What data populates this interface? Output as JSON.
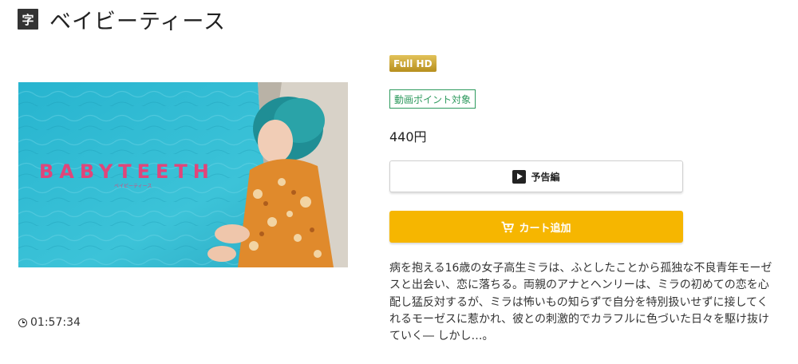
{
  "header": {
    "subtitle_badge": "字",
    "title": "ベイビーティース"
  },
  "thumbnail": {
    "overlay_title": "BABYTEETH",
    "overlay_subtitle": "ベイビーティース",
    "accent_color": "#e0457a"
  },
  "duration": {
    "icon": "clock-icon",
    "value": "01:57:34"
  },
  "badges": {
    "quality": "Full HD",
    "point": "動画ポイント対象"
  },
  "price": "440円",
  "buttons": {
    "trailer": {
      "icon": "play-icon",
      "label": "予告編"
    },
    "cart": {
      "icon": "cart-icon",
      "label": "カート追加",
      "color": "#f6b600"
    }
  },
  "description": "病を抱える16歳の女子高生ミラは、ふとしたことから孤独な不良青年モーゼスと出会い、恋に落ちる。両親のアナとヘンリーは、ミラの初めての恋を心配し猛反対するが、ミラは怖いもの知らずで自分を特別扱いせずに接してくれるモーゼスに惹かれ、彼との刺激的でカラフルに色づいた日々を駆け抜けていく― しかし…。"
}
